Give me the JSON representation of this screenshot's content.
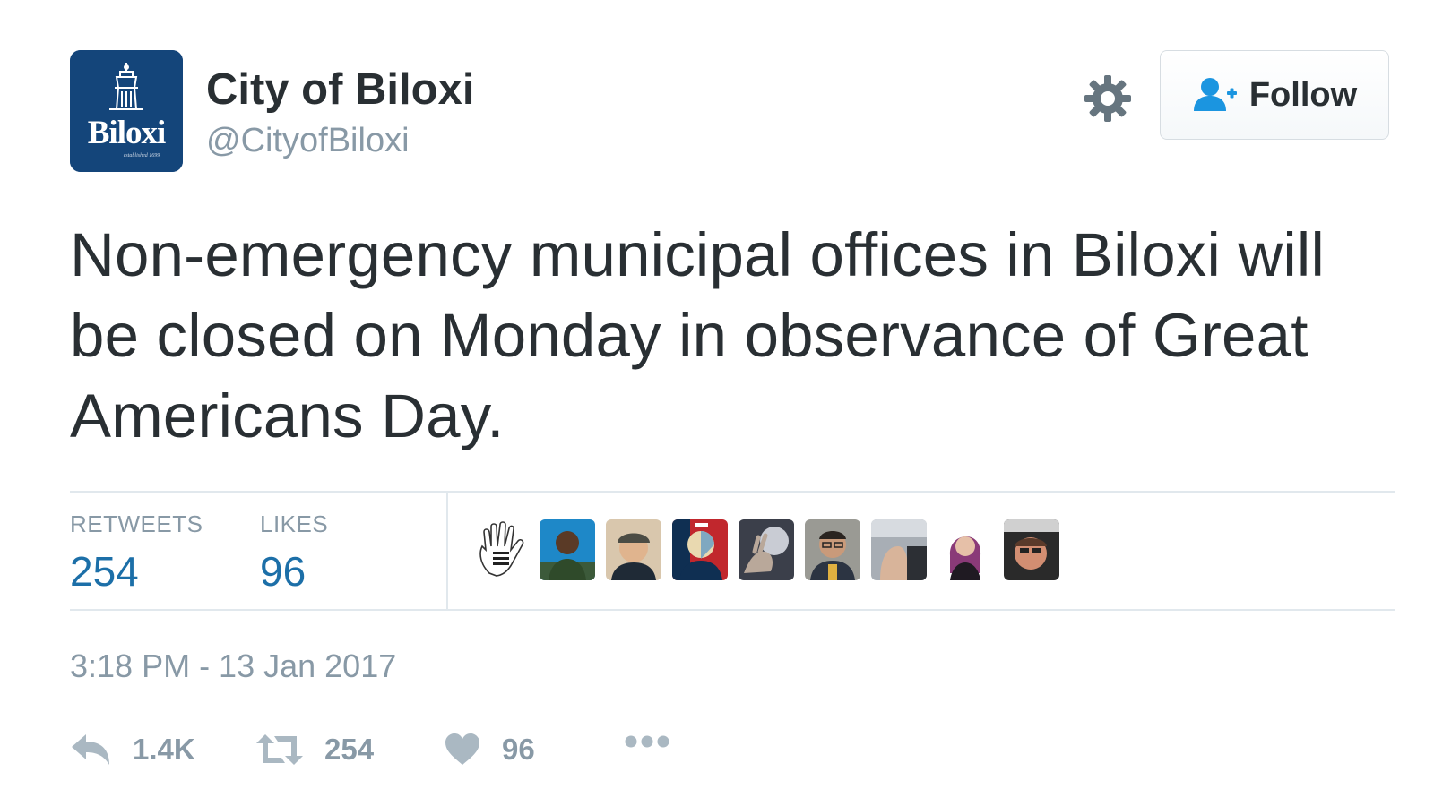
{
  "account": {
    "name": "City of Biloxi",
    "handle": "@CityofBiloxi",
    "avatar_text": "Biloxi",
    "avatar_subtext": "established 1699",
    "avatar_color": "#14457a"
  },
  "header": {
    "follow_label": "Follow",
    "settings_icon": "gear-icon",
    "follow_icon": "add-user-icon"
  },
  "tweet": {
    "text": "Non-emergency municipal offices in Biloxi will be closed on Monday in observance of Great Americans Day.",
    "timestamp": "3:18 PM - 13 Jan 2017"
  },
  "stats": {
    "retweets_label": "RETWEETS",
    "retweets_value": "254",
    "likes_label": "LIKES",
    "likes_value": "96"
  },
  "likers": [
    {
      "name": "liker-avatar-1",
      "bg": "#ffffff"
    },
    {
      "name": "liker-avatar-2",
      "bg": "#1e88c8"
    },
    {
      "name": "liker-avatar-3",
      "bg": "#d9c7ad"
    },
    {
      "name": "liker-avatar-4",
      "bg": "#c1272d"
    },
    {
      "name": "liker-avatar-5",
      "bg": "#6b6f7a"
    },
    {
      "name": "liker-avatar-6",
      "bg": "#9a9a94"
    },
    {
      "name": "liker-avatar-7",
      "bg": "#a8aeb5"
    },
    {
      "name": "liker-avatar-8",
      "bg": "#ffffff"
    },
    {
      "name": "liker-avatar-9",
      "bg": "#2a2a2a"
    }
  ],
  "actions": {
    "reply_count": "1.4K",
    "retweet_count": "254",
    "like_count": "96",
    "reply_icon": "reply-icon",
    "retweet_icon": "retweet-icon",
    "like_icon": "heart-icon",
    "more_icon": "more-icon"
  },
  "colors": {
    "accent": "#1c6fa8",
    "muted": "#8899a6",
    "text": "#292f33",
    "border": "#e1e8ed",
    "follow_icon": "#1b95e0"
  }
}
